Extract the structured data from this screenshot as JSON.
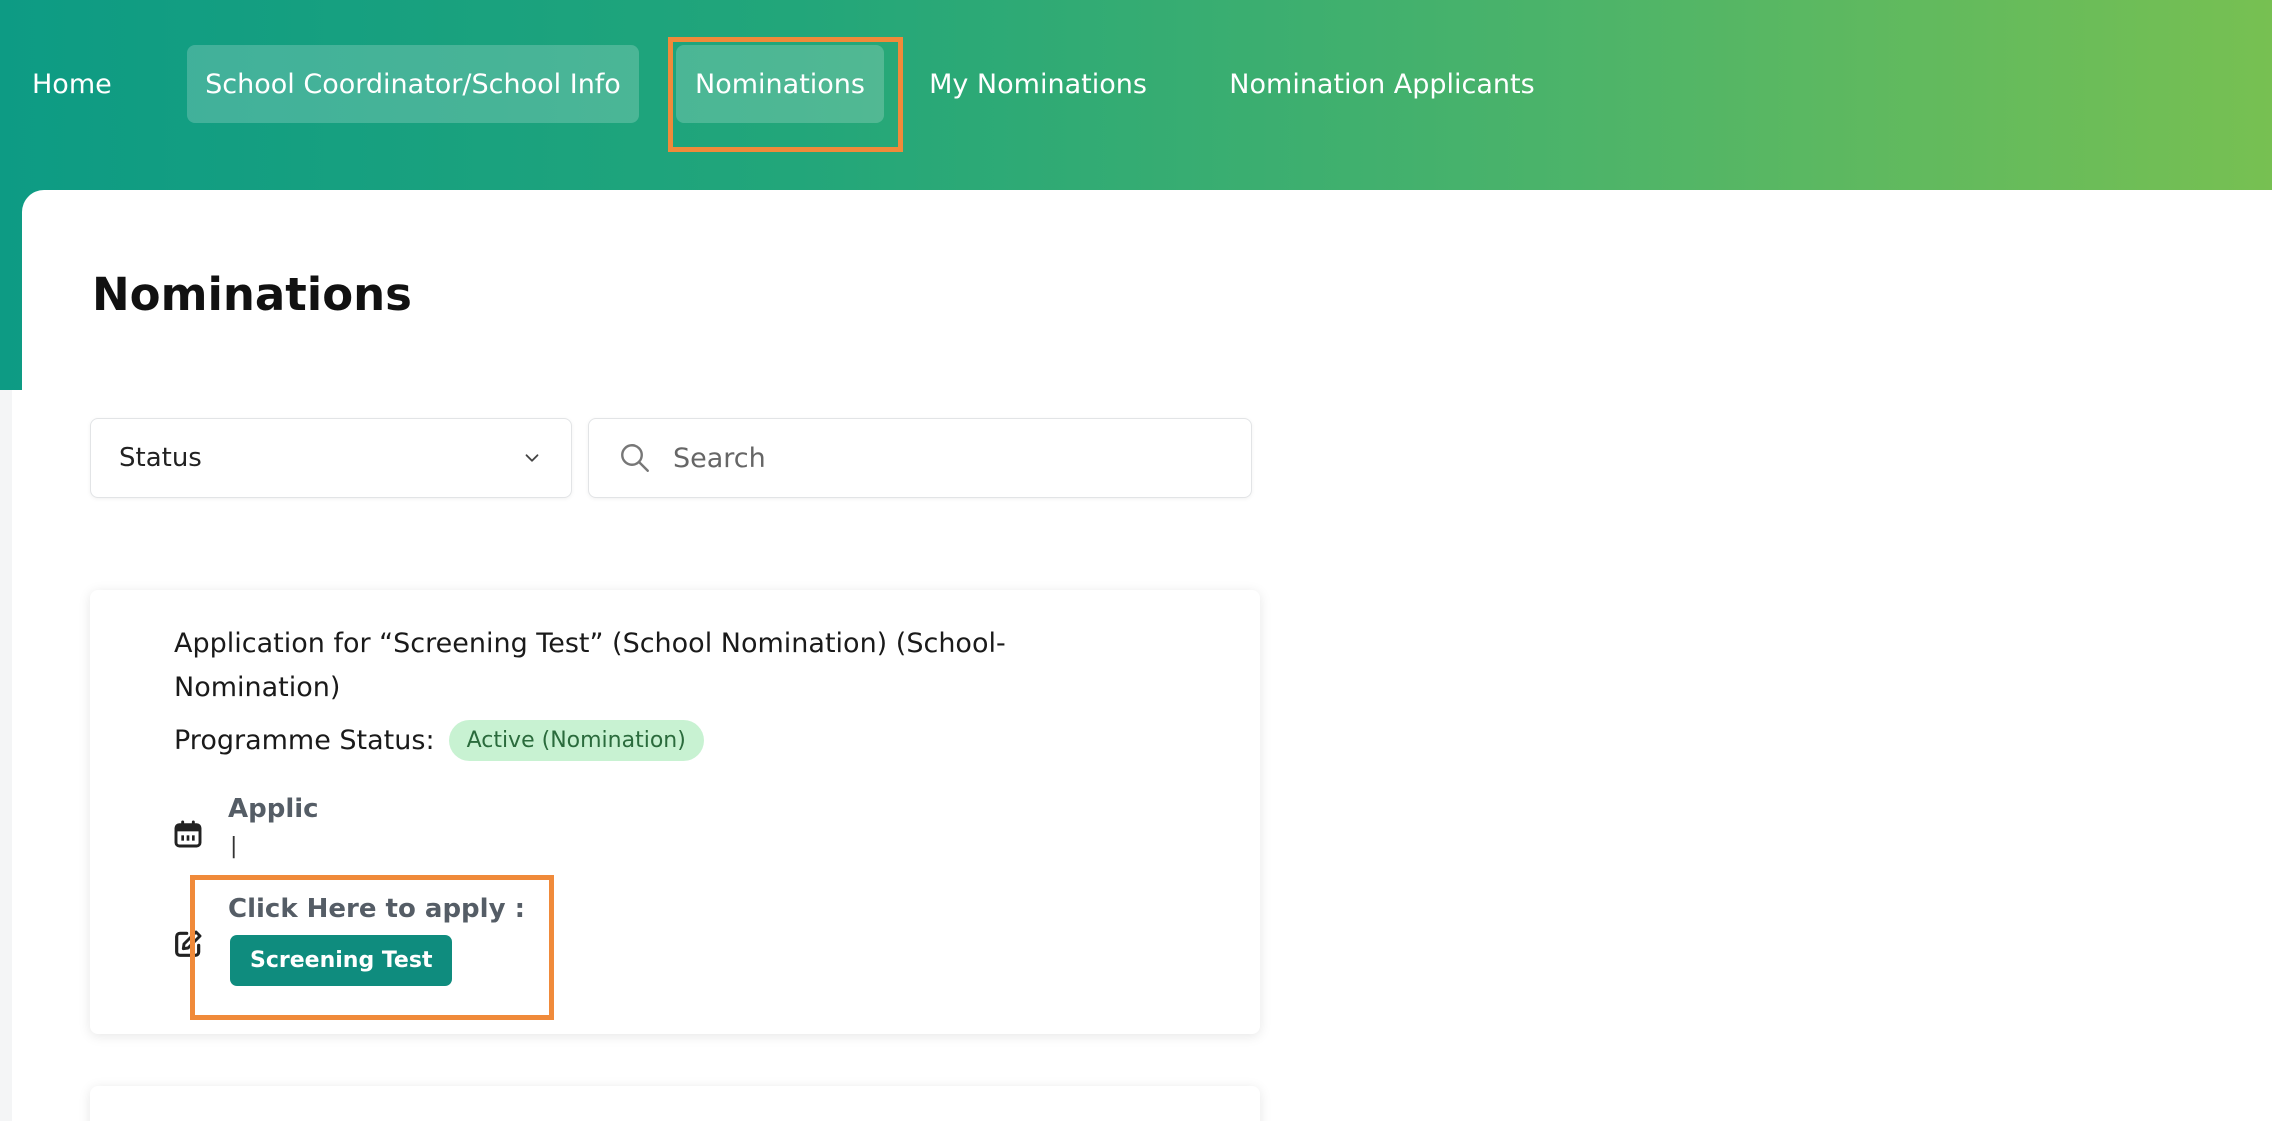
{
  "nav": {
    "items": [
      {
        "label": "Home"
      },
      {
        "label": "School Coordinator/School Info"
      },
      {
        "label": "Nominations"
      },
      {
        "label": "My Nominations"
      },
      {
        "label": "Nomination Applicants"
      }
    ],
    "active": "Nominations"
  },
  "page": {
    "title": "Nominations"
  },
  "filters": {
    "status_label": "Status",
    "search_placeholder": "Search"
  },
  "cards": [
    {
      "title": "Application for “Screening Test”  (School Nomination) (School-Nomination)",
      "status_label": "Programme Status:",
      "status_badge": "Active (Nomination)",
      "applic_label": "Applic",
      "applic_value": "|",
      "apply_label": "Click Here to apply :",
      "apply_button": "Screening Test"
    }
  ],
  "colors": {
    "gradient_start": "#0d9b84",
    "gradient_end": "#77c052",
    "accent_button": "#0f8c7e",
    "badge_bg": "#c8f2d2",
    "highlight": "#f08a3a"
  }
}
